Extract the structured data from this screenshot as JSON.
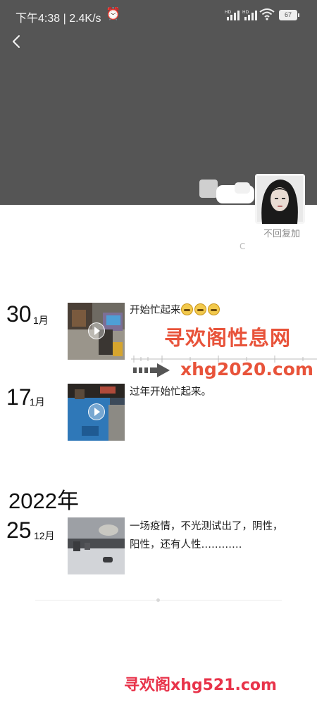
{
  "status_bar": {
    "time_speed": "下午4:38 | 2.4K/s",
    "signal1_label": "HD",
    "signal2_label": "HD",
    "battery": "67"
  },
  "profile": {
    "signature": "不回复加",
    "subline": "C"
  },
  "timeline": {
    "posts_2023": [
      {
        "day": "30",
        "month": "1月",
        "caption": "开始忙起来",
        "emoji_count": 3,
        "media": "video",
        "icons": [
          "play-icon"
        ]
      },
      {
        "day": "17",
        "month": "1月",
        "caption": "过年开始忙起来。",
        "media": "video",
        "icons": [
          "play-icon"
        ]
      }
    ],
    "year_2022_label": "2022年",
    "posts_2022": [
      {
        "day": "25",
        "month": "12月",
        "caption": "一场疫情，不光测试出了，阴性，阳性，还有人性…………",
        "media": "photo"
      }
    ]
  },
  "watermarks": {
    "top_text": "寻欢阁性息网",
    "mid_text": "xhg2020.com",
    "bottom_text": "寻欢阁xhg521.com"
  },
  "colors": {
    "cover": "#555555",
    "watermark": "#e8533a"
  }
}
